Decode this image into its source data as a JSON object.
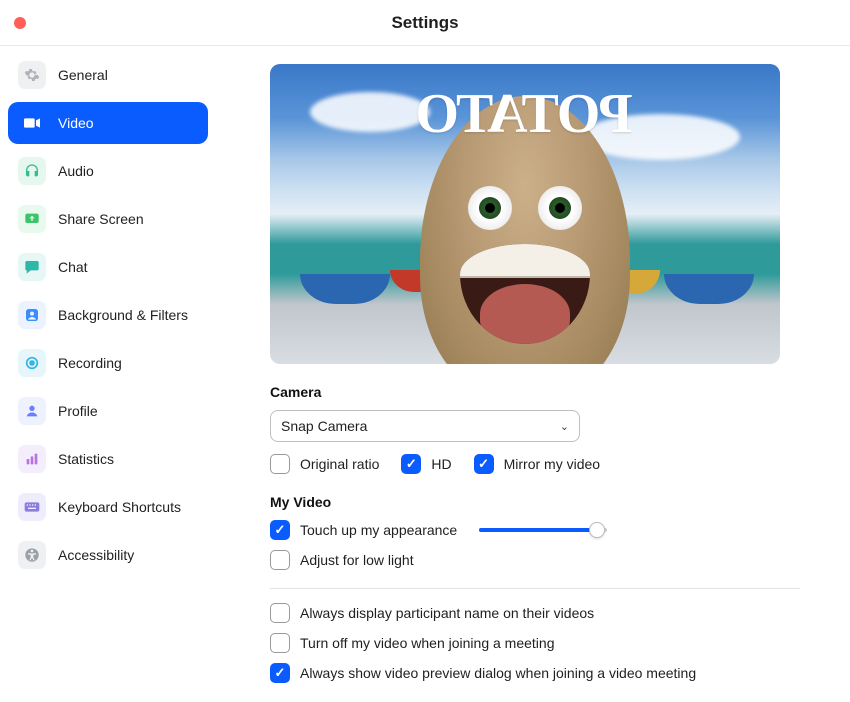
{
  "window": {
    "title": "Settings"
  },
  "sidebar": {
    "items": [
      {
        "key": "general",
        "label": "General",
        "active": false
      },
      {
        "key": "video",
        "label": "Video",
        "active": true
      },
      {
        "key": "audio",
        "label": "Audio",
        "active": false
      },
      {
        "key": "share",
        "label": "Share Screen",
        "active": false
      },
      {
        "key": "chat",
        "label": "Chat",
        "active": false
      },
      {
        "key": "bg",
        "label": "Background & Filters",
        "active": false
      },
      {
        "key": "recording",
        "label": "Recording",
        "active": false
      },
      {
        "key": "profile",
        "label": "Profile",
        "active": false
      },
      {
        "key": "statistics",
        "label": "Statistics",
        "active": false
      },
      {
        "key": "keyboard",
        "label": "Keyboard Shortcuts",
        "active": false
      },
      {
        "key": "accessibility",
        "label": "Accessibility",
        "active": false
      }
    ]
  },
  "preview": {
    "overlay_text": "POTATO"
  },
  "camera": {
    "label": "Camera",
    "selected": "Snap Camera",
    "opts": {
      "original_ratio": {
        "label": "Original ratio",
        "checked": false
      },
      "hd": {
        "label": "HD",
        "checked": true
      },
      "mirror": {
        "label": "Mirror my video",
        "checked": true
      }
    }
  },
  "my_video": {
    "label": "My Video",
    "touch_up": {
      "label": "Touch up my appearance",
      "checked": true,
      "slider_pct": 92
    },
    "low_light": {
      "label": "Adjust for low light",
      "checked": false
    }
  },
  "meeting_opts": {
    "show_name": {
      "label": "Always display participant name on their videos",
      "checked": false
    },
    "off_on_join": {
      "label": "Turn off my video when joining a meeting",
      "checked": false
    },
    "preview_dialog": {
      "label": "Always show video preview dialog when joining a video meeting",
      "checked": true
    }
  }
}
